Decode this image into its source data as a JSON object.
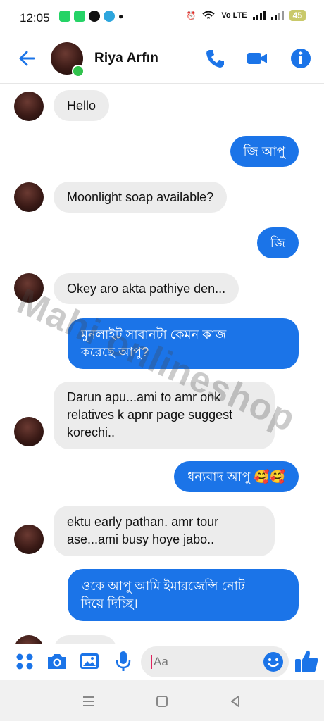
{
  "status_bar": {
    "time": "12:05",
    "network_label": "Vo LTE",
    "battery": "45"
  },
  "header": {
    "contact_name": "Riya Arfın",
    "online": true
  },
  "messages": [
    {
      "dir": "in",
      "text": "Hello"
    },
    {
      "dir": "out",
      "text": "জি আপু"
    },
    {
      "dir": "in",
      "text": "Moonlight soap available?"
    },
    {
      "dir": "out",
      "text": "জি"
    },
    {
      "dir": "in",
      "text": "Okey aro akta pathiye den..."
    },
    {
      "dir": "out",
      "lines": [
        "মুনলাইট সাবানটা কেমন কাজ",
        "করেছে আপু?"
      ]
    },
    {
      "dir": "in",
      "lines": [
        "Darun apu...ami to amr onk",
        "relatives k apnr page suggest",
        "korechi.."
      ]
    },
    {
      "dir": "out",
      "text": "ধন্যবাদ আপু 🥰🥰"
    },
    {
      "dir": "in",
      "lines": [
        "ektu early pathan. amr tour",
        "ase...ami busy hoye jabo.."
      ]
    },
    {
      "dir": "out",
      "lines": [
        "ওকে আপু আমি ইমারজেন্সি নোট",
        "দিয়ে দিচ্ছি।"
      ]
    }
  ],
  "watermark": "Mahi onlineshop",
  "composer": {
    "placeholder": "Aa"
  },
  "colors": {
    "accent": "#1b74e8",
    "incoming_bubble": "#ececec",
    "online": "#31c24d"
  },
  "icons": [
    "back-arrow-icon",
    "phone-icon",
    "video-icon",
    "info-icon",
    "menu-dots-icon",
    "camera-icon",
    "gallery-icon",
    "mic-icon",
    "emoji-icon",
    "like-icon"
  ]
}
